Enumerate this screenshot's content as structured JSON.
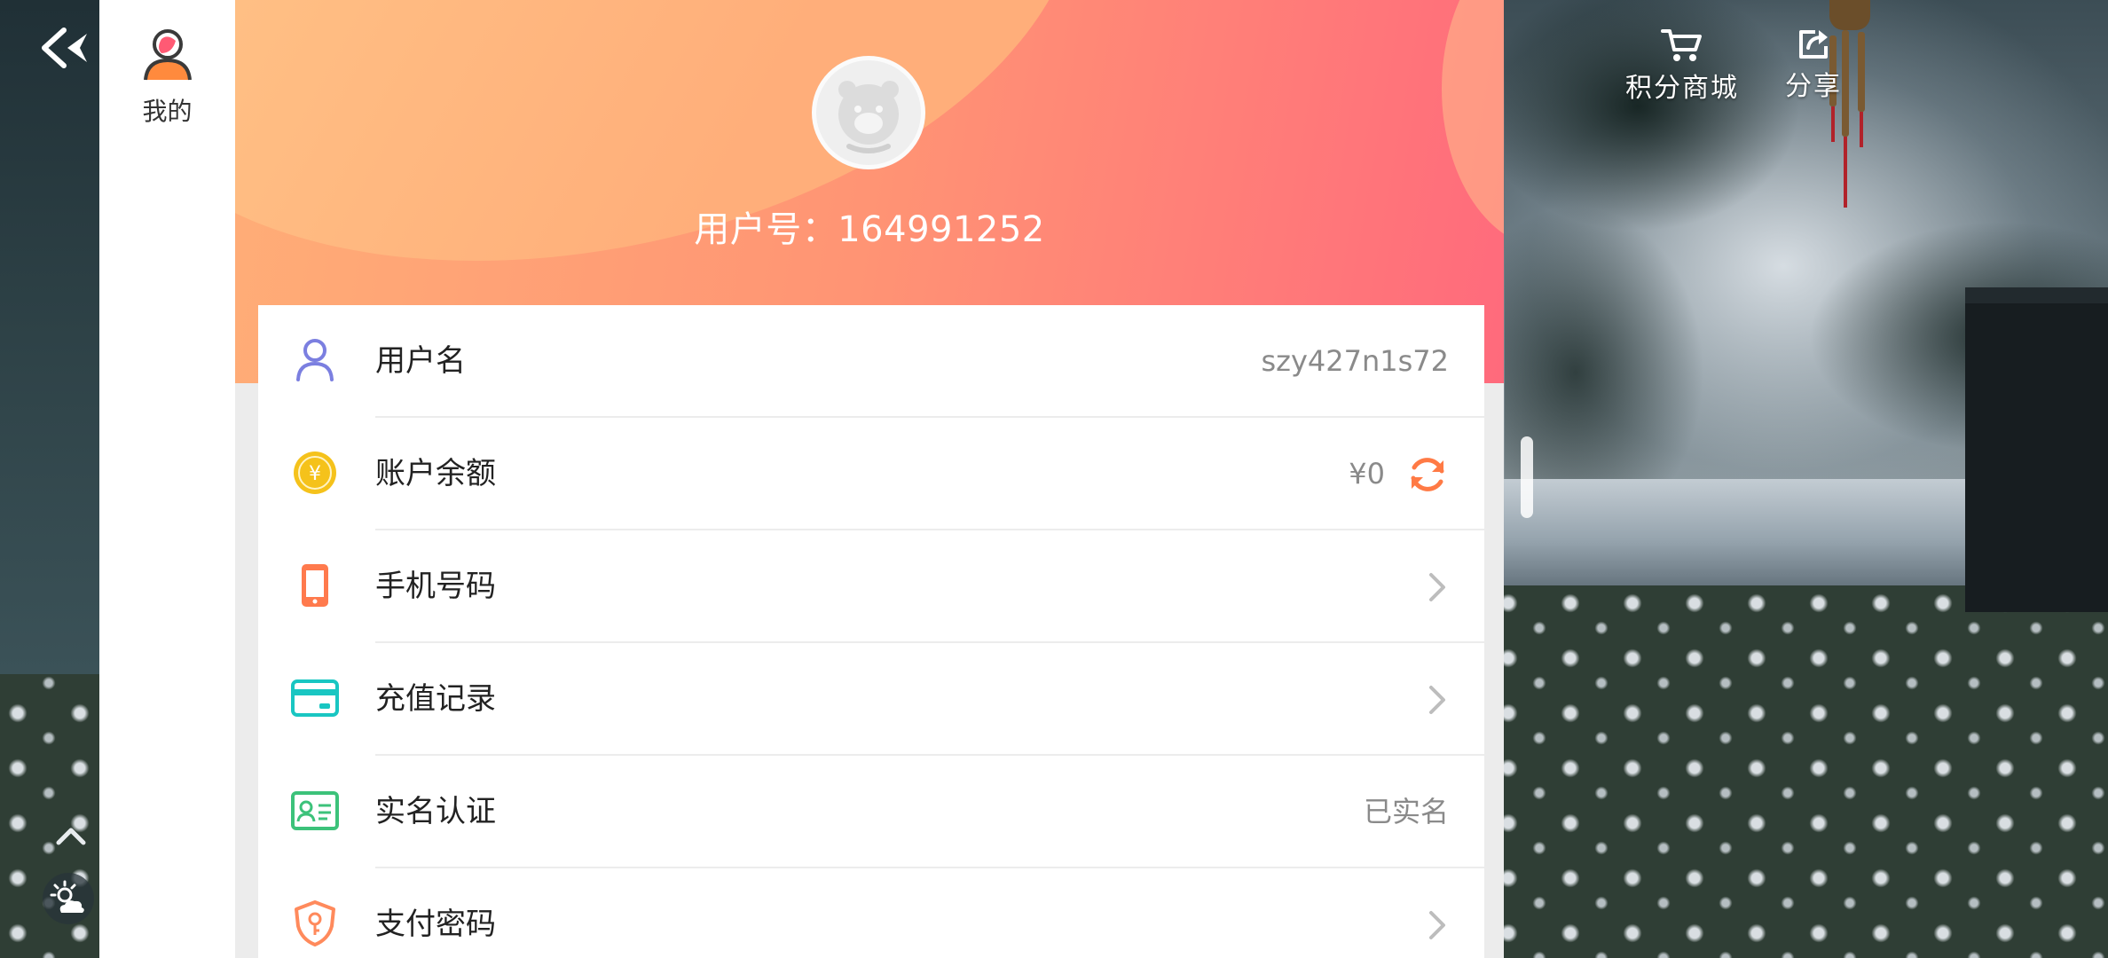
{
  "rail": {
    "tab_label": "我的"
  },
  "hero": {
    "user_id_label": "用户号：164991252"
  },
  "rows": [
    {
      "label": "用户名",
      "value": "szy427n1s72"
    },
    {
      "label": "账户余额",
      "value": "¥0"
    },
    {
      "label": "手机号码",
      "value": ""
    },
    {
      "label": "充值记录",
      "value": ""
    },
    {
      "label": "实名认证",
      "value": "已实名"
    },
    {
      "label": "支付密码",
      "value": ""
    }
  ],
  "top_actions": {
    "mall_label": "积分商城",
    "share_label": "分享"
  },
  "icons": {
    "back": "back-arrow-icon",
    "profile": "profile-icon",
    "username": "user-icon",
    "balance": "coin-icon",
    "refresh": "refresh-icon",
    "phone": "phone-icon",
    "recharge": "card-icon",
    "realname": "id-card-icon",
    "paypwd": "shield-key-icon",
    "chevron": "chevron-right-icon",
    "mall": "cart-icon",
    "share": "share-icon"
  },
  "colors": {
    "hero_start": "#ffae77",
    "hero_end": "#ff6a7c",
    "accent_orange": "#ff7a45",
    "user_icon": "#7b7fe0",
    "coin_yellow": "#f5c21b",
    "phone_orange": "#ff7a4d",
    "card_teal": "#19c6c2",
    "id_green": "#3cc27a"
  }
}
